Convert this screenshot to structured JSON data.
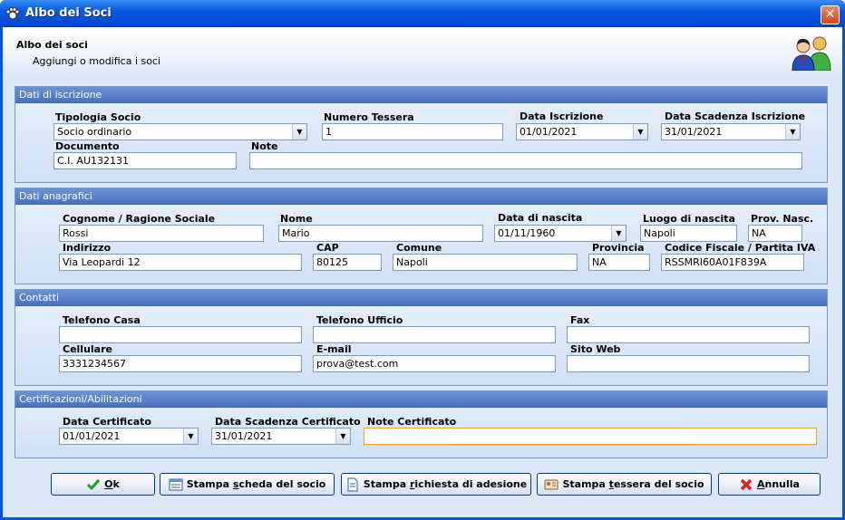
{
  "window": {
    "title": "Albo dei Soci",
    "close_glyph": "✕"
  },
  "header": {
    "title": "Albo dei soci",
    "subtitle": "Aggiungi o modifica i soci",
    "icon": "users-icon"
  },
  "iscrizione": {
    "title": "Dati di iscrizione",
    "tipologia_label": "Tipologia Socio",
    "tipologia_value": "Socio ordinario",
    "numero_label": "Numero Tessera",
    "numero_value": "1",
    "data_iscr_label": "Data Iscrizione",
    "data_iscr_value": "01/01/2021",
    "scadenza_label": "Data Scadenza Iscrizione",
    "scadenza_value": "31/01/2021",
    "documento_label": "Documento",
    "documento_value": "C.I. AU132131",
    "note_label": "Note",
    "note_value": ""
  },
  "anagrafici": {
    "title": "Dati anagrafici",
    "cognome_label": "Cognome / Ragione Sociale",
    "cognome_value": "Rossi",
    "nome_label": "Nome",
    "nome_value": "Mario",
    "nascita_label": "Data di nascita",
    "nascita_value": "01/11/1960",
    "luogo_label": "Luogo di nascita",
    "luogo_value": "Napoli",
    "prov_nasc_label": "Prov. Nasc.",
    "prov_nasc_value": "NA",
    "indirizzo_label": "Indirizzo",
    "indirizzo_value": "Via Leopardi 12",
    "cap_label": "CAP",
    "cap_value": "80125",
    "comune_label": "Comune",
    "comune_value": "Napoli",
    "provincia_label": "Provincia",
    "provincia_value": "NA",
    "cf_label": "Codice Fiscale / Partita IVA",
    "cf_value": "RSSMRI60A01F839A"
  },
  "contatti": {
    "title": "Contatti",
    "tel_casa_label": "Telefono Casa",
    "tel_casa_value": "",
    "tel_uff_label": "Telefono Ufficio",
    "tel_uff_value": "",
    "fax_label": "Fax",
    "fax_value": "",
    "cell_label": "Cellulare",
    "cell_value": "3331234567",
    "email_label": "E-mail",
    "email_value": "prova@test.com",
    "web_label": "Sito Web",
    "web_value": ""
  },
  "certificazioni": {
    "title": "Certificazioni/Abilitazioni",
    "data_cert_label": "Data Certificato",
    "data_cert_value": "01/01/2021",
    "scad_cert_label": "Data Scadenza Certificato",
    "scad_cert_value": "31/01/2021",
    "note_cert_label": "Note Certificato",
    "note_cert_value": ""
  },
  "buttons": {
    "ok_pre": "",
    "ok_u": "O",
    "ok_post": "k",
    "scheda_pre": "Stampa ",
    "scheda_u": "s",
    "scheda_post": "cheda del socio",
    "richiesta_pre": "Stampa ",
    "richiesta_u": "r",
    "richiesta_post": "ichiesta di adesione",
    "tessera_pre": "Stampa ",
    "tessera_u": "t",
    "tessera_post": "essera del socio",
    "annulla_pre": "",
    "annulla_u": "A",
    "annulla_post": "nnulla"
  },
  "dropdown_glyph": "▼"
}
